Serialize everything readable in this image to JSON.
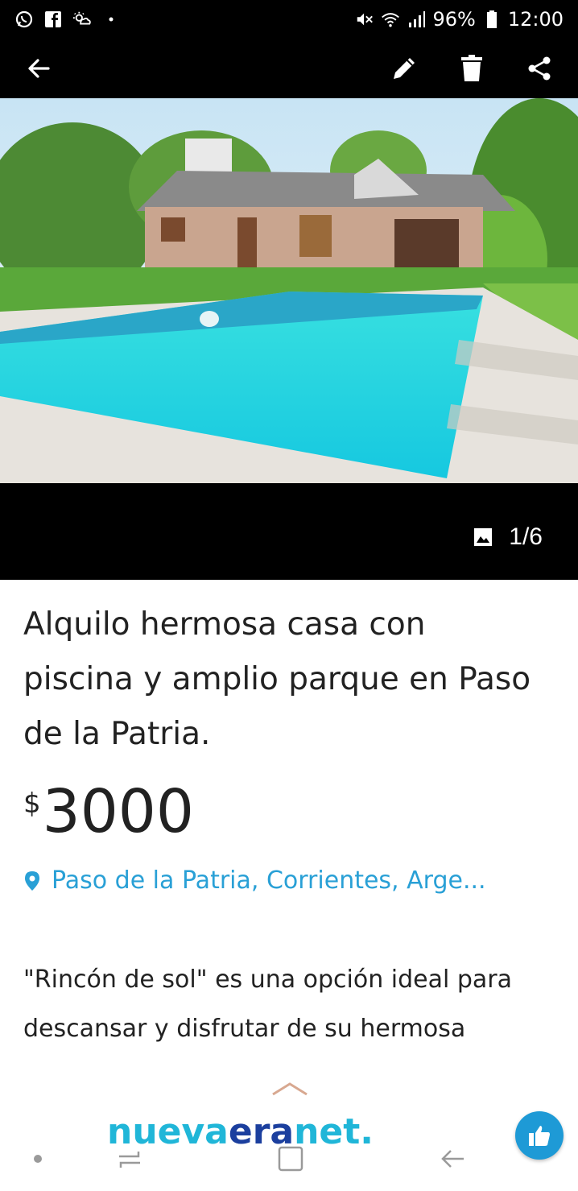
{
  "status_bar": {
    "battery": "96%",
    "time": "12:00",
    "left_icons": [
      "whatsapp-icon",
      "facebook-icon",
      "weather-icon",
      "dot-icon"
    ],
    "right_icons": [
      "mute-icon",
      "wifi-icon",
      "signal-icon",
      "battery-icon"
    ]
  },
  "app_bar": {
    "icons": [
      "back-arrow-icon",
      "edit-pencil-icon",
      "delete-trash-icon",
      "share-icon"
    ]
  },
  "gallery": {
    "counter": "1/6",
    "counter_icon": "image-icon"
  },
  "listing": {
    "title": "Alquilo hermosa casa con piscina y amplio parque en Paso de la Patria.",
    "currency": "$",
    "price": "3000",
    "location": "Paso de la Patria, Corrientes, Arge...",
    "description": "\"Rincón de sol\" es una opción ideal para descansar y disfrutar de su hermosa"
  },
  "watermark": {
    "part1": "nueva",
    "part2": "era",
    "part3": "net."
  },
  "colors": {
    "accent": "#29a0d6",
    "fab": "#1e9ad6",
    "bars": "#000000"
  }
}
